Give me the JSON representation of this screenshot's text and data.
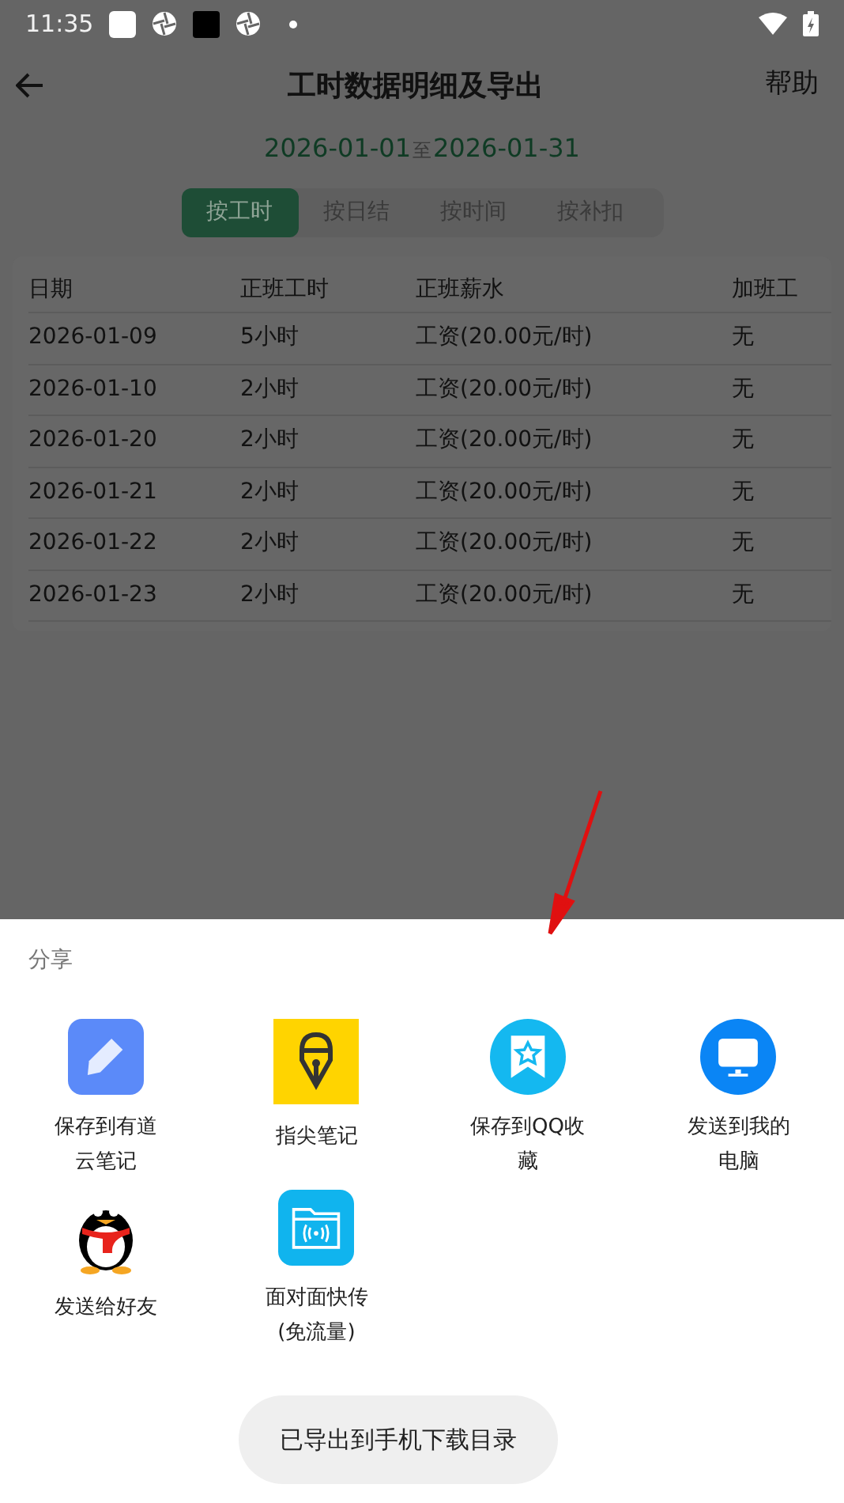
{
  "status_bar": {
    "time": "11:35"
  },
  "header": {
    "title": "工时数据明细及导出",
    "help": "帮助"
  },
  "date_range": {
    "start": "2026-01-01",
    "separator": "至",
    "end": "2026-01-31"
  },
  "tabs": [
    {
      "label": "按工时",
      "selected": true
    },
    {
      "label": "按日结",
      "selected": false
    },
    {
      "label": "按时间",
      "selected": false
    },
    {
      "label": "按补扣",
      "selected": false
    }
  ],
  "table": {
    "columns": [
      "日期",
      "正班工时",
      "正班薪水",
      "加班工"
    ],
    "rows": [
      [
        "2026-01-09",
        "5小时",
        "工资(20.00元/时)",
        "无"
      ],
      [
        "2026-01-10",
        "2小时",
        "工资(20.00元/时)",
        "无"
      ],
      [
        "2026-01-20",
        "2小时",
        "工资(20.00元/时)",
        "无"
      ],
      [
        "2026-01-21",
        "2小时",
        "工资(20.00元/时)",
        "无"
      ],
      [
        "2026-01-22",
        "2小时",
        "工资(20.00元/时)",
        "无"
      ],
      [
        "2026-01-23",
        "2小时",
        "工资(20.00元/时)",
        "无"
      ]
    ]
  },
  "share_sheet": {
    "title": "分享",
    "targets": [
      {
        "kind": "note",
        "label": "保存到有道云笔记"
      },
      {
        "kind": "pen",
        "label": "指尖笔记"
      },
      {
        "kind": "favorite",
        "label": "保存到QQ收藏"
      },
      {
        "kind": "computer",
        "label": "发送到我的电脑"
      },
      {
        "kind": "penguin",
        "label": "发送给好友"
      },
      {
        "kind": "transfer",
        "label": "面对面快传(免流量)"
      }
    ]
  },
  "toast": "已导出到手机下载目录"
}
